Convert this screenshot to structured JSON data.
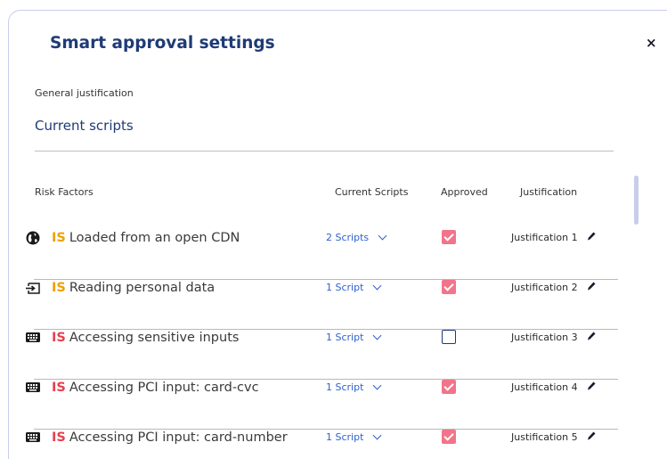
{
  "dialog": {
    "title": "Smart approval settings",
    "close_label": "×",
    "general_justification_label": "General justification",
    "general_justification_value": "Current scripts"
  },
  "table": {
    "headers": {
      "risk_factors": "Risk Factors",
      "current_scripts": "Current Scripts",
      "approved": "Approved",
      "justification": "Justification"
    },
    "rows": [
      {
        "icon": "globe-icon",
        "tag": "IS",
        "tag_color": "#f0a000",
        "label": "Loaded from an open CDN",
        "scripts": "2 Scripts",
        "approved": true,
        "justification": "Justification 1"
      },
      {
        "icon": "input-arrow-icon",
        "tag": "IS",
        "tag_color": "#f0a000",
        "label": "Reading personal data",
        "scripts": "1 Script",
        "approved": true,
        "justification": "Justification 2"
      },
      {
        "icon": "keyboard-icon",
        "tag": "IS",
        "tag_color": "#e8404f",
        "label": "Accessing sensitive inputs",
        "scripts": "1 Script",
        "approved": false,
        "justification": "Justification 3"
      },
      {
        "icon": "keyboard-icon",
        "tag": "IS",
        "tag_color": "#e8404f",
        "label": "Accessing PCI input: card-cvc",
        "scripts": "1 Script",
        "approved": true,
        "justification": "Justification 4"
      },
      {
        "icon": "keyboard-icon",
        "tag": "IS",
        "tag_color": "#e8404f",
        "label": "Accessing PCI input: card-number",
        "scripts": "1 Script",
        "approved": true,
        "justification": "Justification 5"
      }
    ]
  },
  "colors": {
    "title": "#1f3b76",
    "link": "#2f5fd0",
    "checkbox_checked": "#f2748a",
    "border": "#c9cdea"
  }
}
